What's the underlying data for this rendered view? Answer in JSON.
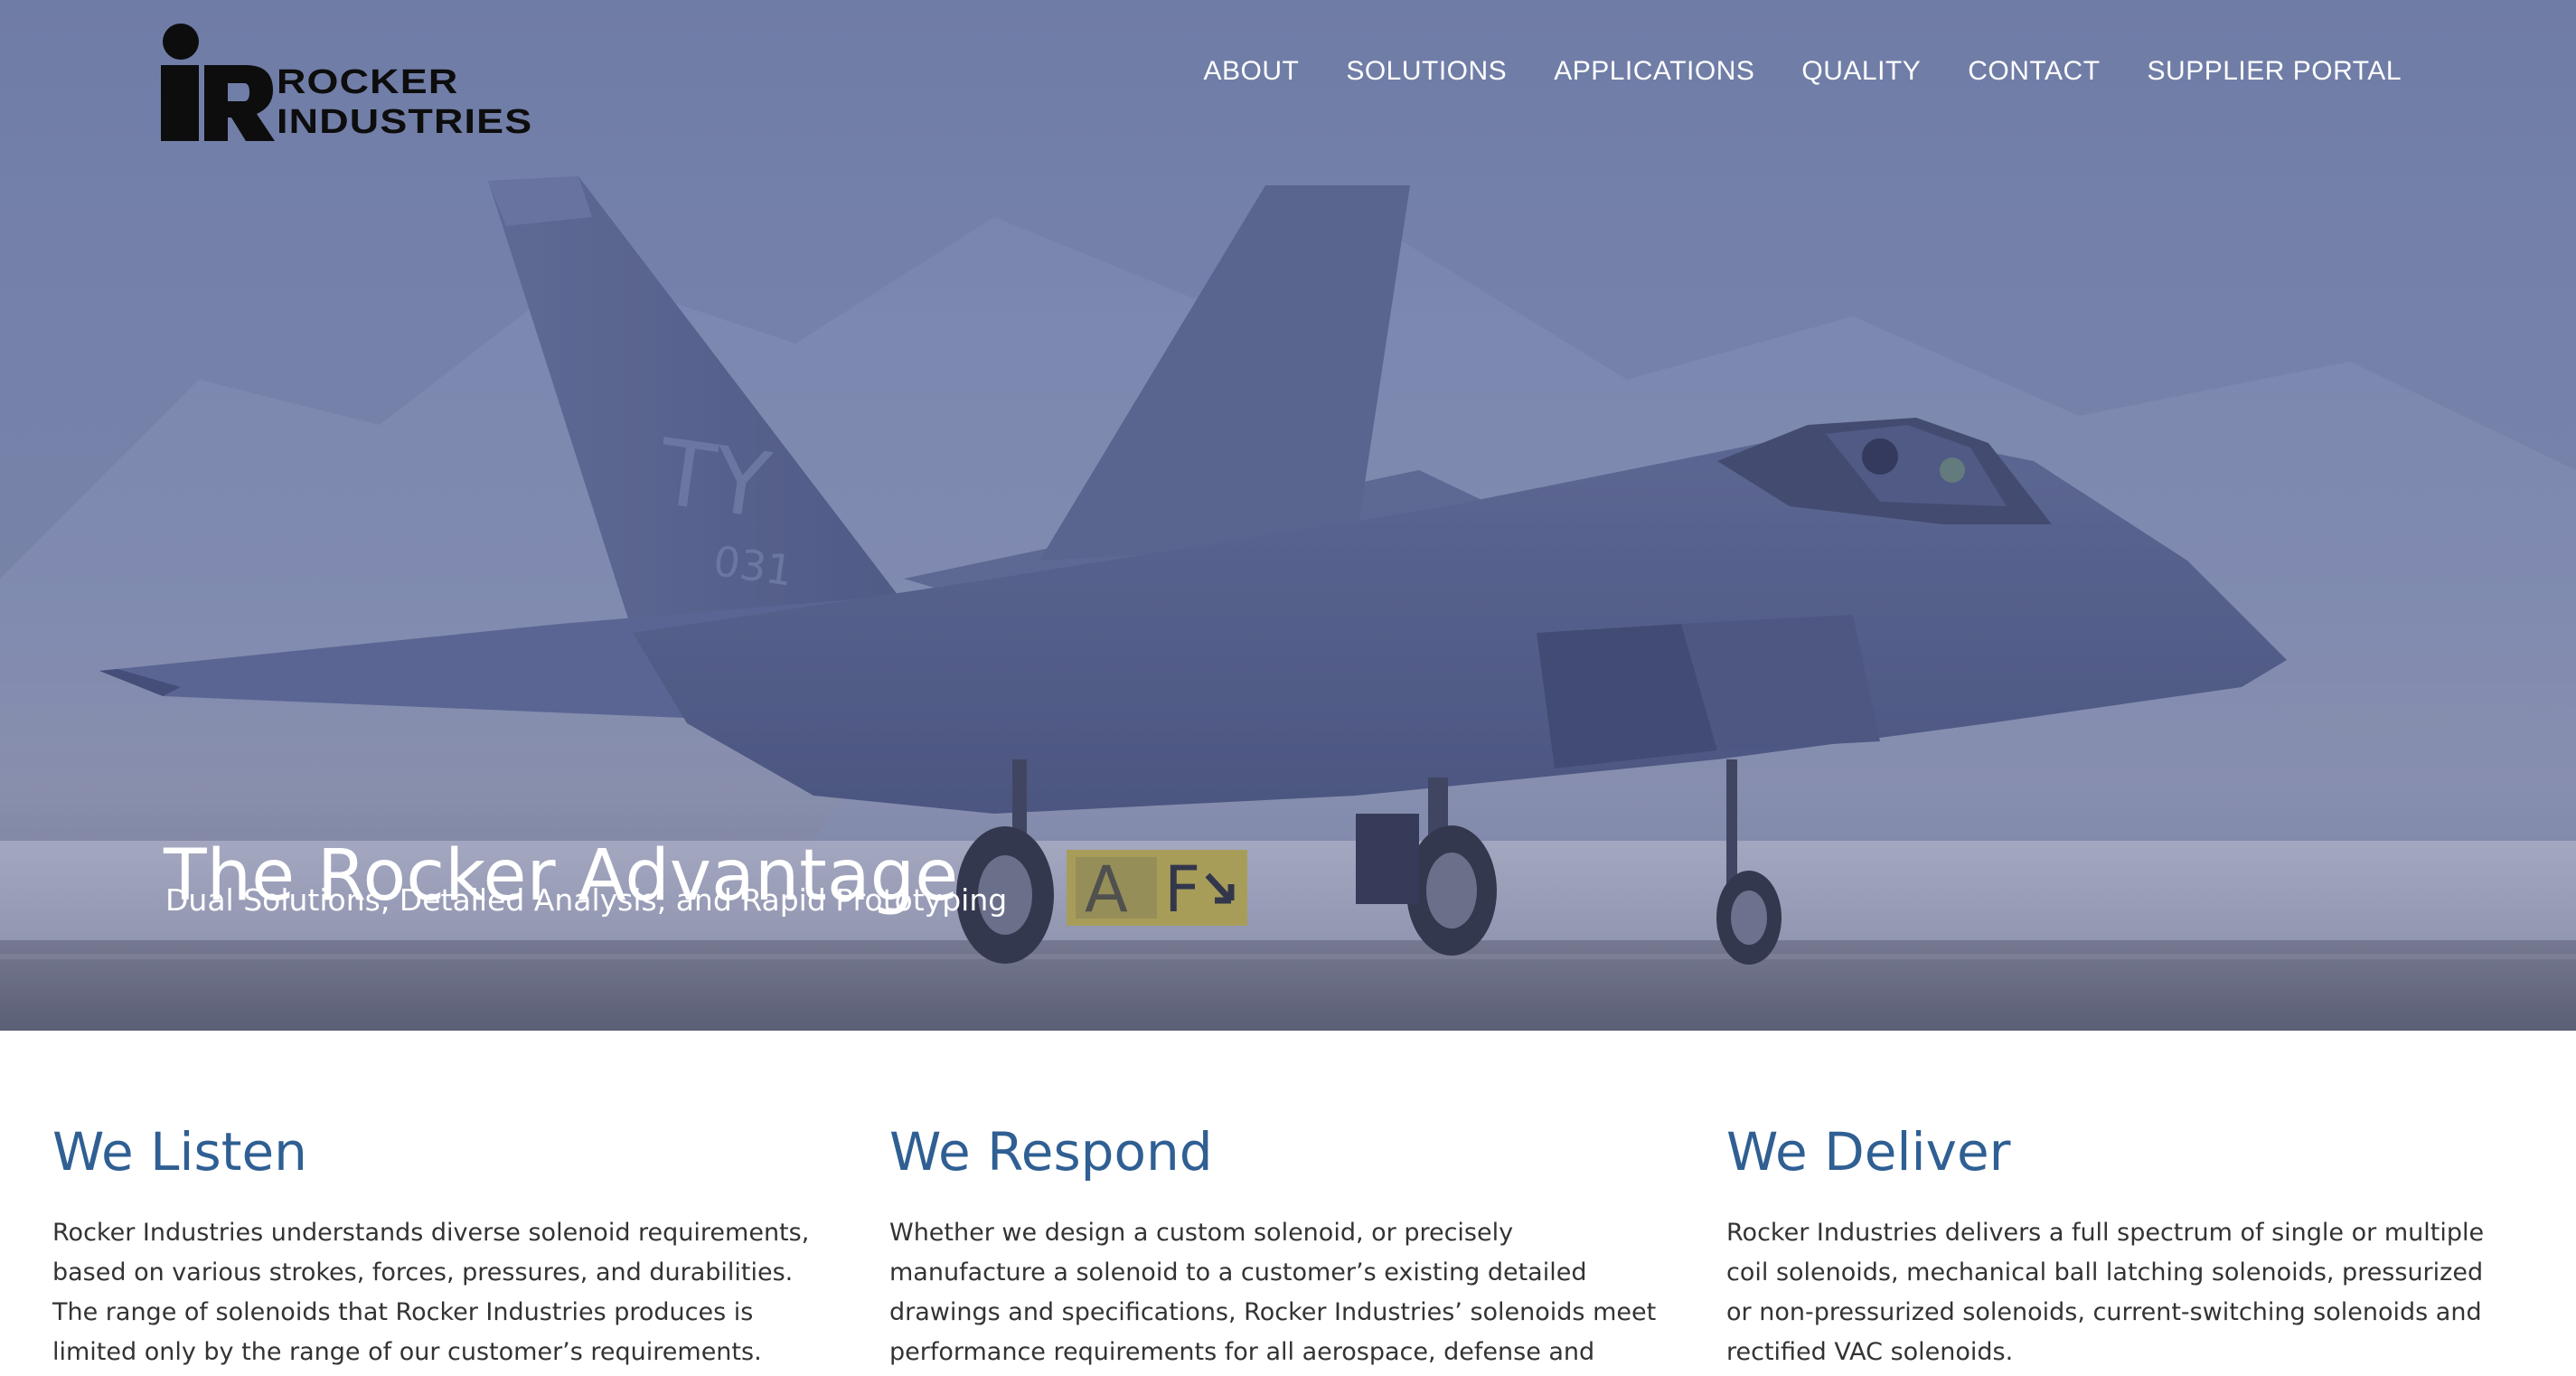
{
  "brand": {
    "line1": "ROCKER",
    "line2": "INDUSTRIES"
  },
  "nav": [
    {
      "label": "ABOUT"
    },
    {
      "label": "SOLUTIONS"
    },
    {
      "label": "APPLICATIONS"
    },
    {
      "label": "QUALITY"
    },
    {
      "label": "CONTACT"
    },
    {
      "label": "SUPPLIER PORTAL"
    }
  ],
  "hero": {
    "title": "The Rocker Advantage",
    "subtitle": "Dual Solutions, Detailed Analysis, and Rapid Prototyping",
    "image_subject": "fighter-jet-on-runway",
    "tail_code": "TY",
    "tail_number": "031",
    "runway_sign": "F"
  },
  "columns": [
    {
      "title": "We Listen",
      "body": "Rocker Industries understands diverse solenoid requirements, based on various strokes, forces, pressures, and durabilities. The range of solenoids that Rocker Industries produces is limited only by the range of our customer’s requirements."
    },
    {
      "title": "We Respond",
      "body": "Whether we design a custom solenoid, or precisely manufacture a solenoid to a customer’s existing detailed drawings and specifications, Rocker Industries’ solenoids meet performance requirements for all aerospace, defense and commercial applications."
    },
    {
      "title": "We Deliver",
      "body": "Rocker Industries delivers a full spectrum of single or multiple coil solenoids, mechanical ball latching solenoids, pressurized or non-pressurized solenoids, current-switching solenoids and rectified VAC solenoids."
    }
  ],
  "colors": {
    "heading_blue": "#2f5f93",
    "body_text": "#333333",
    "hero_tint": "#7381a8"
  }
}
